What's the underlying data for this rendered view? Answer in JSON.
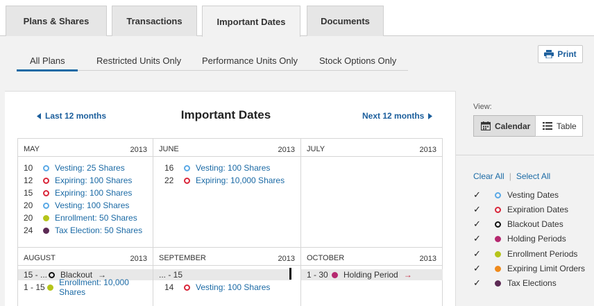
{
  "tabs": [
    "Plans & Shares",
    "Transactions",
    "Important Dates",
    "Documents"
  ],
  "subtabs": [
    "All Plans",
    "Restricted Units Only",
    "Performance Units Only",
    "Stock Options Only"
  ],
  "print_label": "Print",
  "calendar": {
    "prev_label": "Last 12 months",
    "title": "Important Dates",
    "next_label": "Next 12 months",
    "months": [
      {
        "name": "MAY",
        "year": "2013",
        "events": [
          {
            "day": "10",
            "type": "vesting",
            "label": "Vesting: 25 Shares"
          },
          {
            "day": "12",
            "type": "expiration",
            "label": "Expiring: 100 Shares"
          },
          {
            "day": "15",
            "type": "expiration",
            "label": "Expiring: 100 Shares"
          },
          {
            "day": "20",
            "type": "vesting",
            "label": "Vesting: 100 Shares"
          },
          {
            "day": "20",
            "type": "enrollment",
            "label": "Enrollment: 50 Shares"
          },
          {
            "day": "24",
            "type": "tax",
            "label": "Tax Election: 50 Shares"
          }
        ]
      },
      {
        "name": "JUNE",
        "year": "2013",
        "events": [
          {
            "day": "16",
            "type": "vesting",
            "label": "Vesting: 100 Shares"
          },
          {
            "day": "22",
            "type": "expiration",
            "label": "Expiring: 10,000 Shares"
          }
        ]
      },
      {
        "name": "JULY",
        "year": "2013",
        "events": []
      },
      {
        "name": "AUGUST",
        "year": "2013",
        "events": [
          {
            "day": "15 - ...",
            "type": "blackout",
            "label": "Blackout"
          },
          {
            "day": "1 - 15",
            "type": "enrollment",
            "label": "Enrollment: 10,000 Shares"
          }
        ]
      },
      {
        "name": "SEPTEMBER",
        "year": "2013",
        "events": [
          {
            "day": "... - 15",
            "type": "",
            "label": ""
          },
          {
            "day": "14",
            "type": "expiration",
            "label": "Vesting: 100 Shares"
          }
        ]
      },
      {
        "name": "OCTOBER",
        "year": "2013",
        "events": [
          {
            "day": "1 - 30",
            "type": "holding",
            "label": "Holding Period"
          }
        ]
      }
    ]
  },
  "view": {
    "label": "View:",
    "calendar_label": "Calendar",
    "table_label": "Table"
  },
  "filters": {
    "clear_all": "Clear All",
    "select_all": "Select All",
    "items": [
      {
        "label": "Vesting Dates",
        "checked": true,
        "color": "#5aa9e6",
        "style": "ring"
      },
      {
        "label": "Expiration Dates",
        "checked": true,
        "color": "#d9263a",
        "style": "ring"
      },
      {
        "label": "Blackout Dates",
        "checked": true,
        "color": "#111111",
        "style": "ring"
      },
      {
        "label": "Holding Periods",
        "checked": true,
        "color": "#b5286f",
        "style": "solid"
      },
      {
        "label": "Enrollment Periods",
        "checked": true,
        "color": "#b5c41a",
        "style": "solid"
      },
      {
        "label": "Expiring Limit Orders",
        "checked": true,
        "color": "#ef8a1c",
        "style": "solid"
      },
      {
        "label": "Tax Elections",
        "checked": true,
        "color": "#5c2a54",
        "style": "solid"
      }
    ],
    "check_glyph": "✓"
  },
  "colors": {
    "link": "#1b6aa5",
    "accent": "#1b6aa5",
    "vesting": "#5aa9e6",
    "expiration": "#d9263a",
    "blackout": "#111111",
    "holding": "#b5286f",
    "enrollment": "#b5c41a",
    "tax": "#5c2a54"
  }
}
